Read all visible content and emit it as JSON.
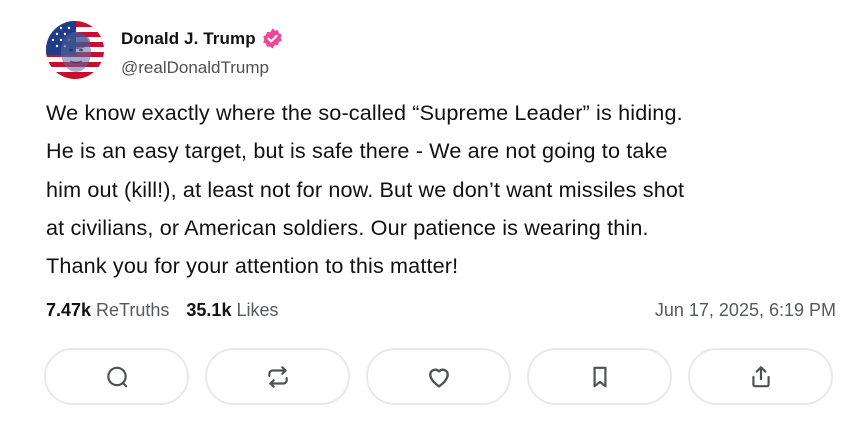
{
  "author": {
    "display_name": "Donald J. Trump",
    "handle": "@realDonaldTrump",
    "verified": true,
    "verified_color": "#ec4899"
  },
  "post": {
    "text": "We know exactly where the so-called “Supreme Leader” is hiding.\nHe is an easy target, but is safe there - We are not going to take\nhim out (kill!), at least not for now. But we don’t want missiles shot\nat civilians, or American soldiers. Our patience is wearing thin.\nThank you for your attention to this matter!",
    "retruths_count": "7.47k",
    "retruths_label": "ReTruths",
    "likes_count": "35.1k",
    "likes_label": "Likes",
    "timestamp": "Jun 17, 2025, 6:19 PM"
  },
  "actions": [
    {
      "icon": "reply-icon"
    },
    {
      "icon": "retruth-icon"
    },
    {
      "icon": "heart-icon"
    },
    {
      "icon": "bookmark-icon"
    },
    {
      "icon": "share-icon"
    }
  ],
  "colors": {
    "text": "#111111",
    "muted": "#565a60",
    "button_border": "#e8e9ec",
    "icon": "#4d5157"
  }
}
